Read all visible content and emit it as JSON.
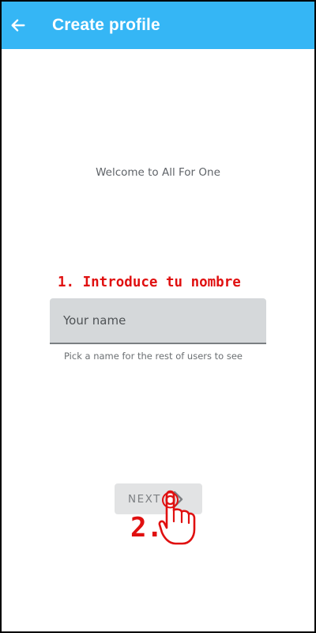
{
  "app_bar": {
    "title": "Create profile",
    "back_icon": "arrow-left-icon",
    "background_color": "#35b6f5"
  },
  "content": {
    "welcome_text": "Welcome to All For One",
    "name_field": {
      "placeholder": "Your name",
      "value": "",
      "helper_text": "Pick a name for the rest of users to see"
    },
    "next_button": {
      "label": "NEXT",
      "icon": "chevron-right-icon",
      "enabled": false
    }
  },
  "annotations": {
    "step1_text": "1. Introduce tu nombre",
    "step2_text": "2.",
    "pointer_icon": "hand-pointer-icon",
    "color": "#e01010"
  }
}
